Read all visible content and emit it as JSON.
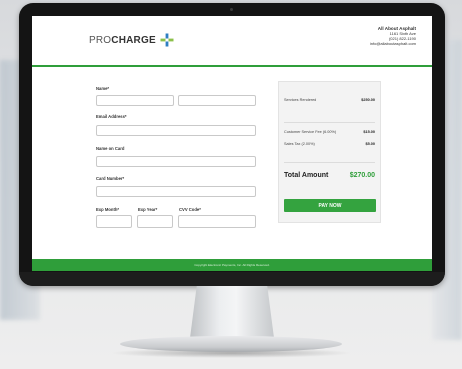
{
  "header": {
    "logo_pro": "PRO",
    "logo_charge": "CHARGE",
    "logo_icon": "plus-cross-icon",
    "company_name": "All About Asphalt",
    "address": "1161 Sixth Ave",
    "phone": "(021) 822-1190",
    "email": "info@allaboutasphalt.com"
  },
  "form": {
    "name_label": "Name*",
    "email_label": "Email Address*",
    "name_on_card_label": "Name on Card",
    "card_number_label": "Card Number*",
    "exp_month_label": "Exp Month*",
    "exp_year_label": "Exp Year*",
    "cvv_label": "CVV Code*"
  },
  "summary": {
    "services_label": "Services Rendered",
    "services_value": "$250.00",
    "fee_label": "Customer Service Fee (6.00%)",
    "fee_value": "$15.00",
    "tax_label": "Sales Tax (2.00%)",
    "tax_value": "$5.00",
    "total_label": "Total Amount",
    "total_value": "$270.00",
    "pay_button": "PAY NOW"
  },
  "footer": {
    "copyright": "Copyright Electronic Payments, Inc. All Rights Reserved."
  },
  "colors": {
    "accent_green": "#2f9e3a",
    "logo_blue": "#2f7fc2"
  }
}
